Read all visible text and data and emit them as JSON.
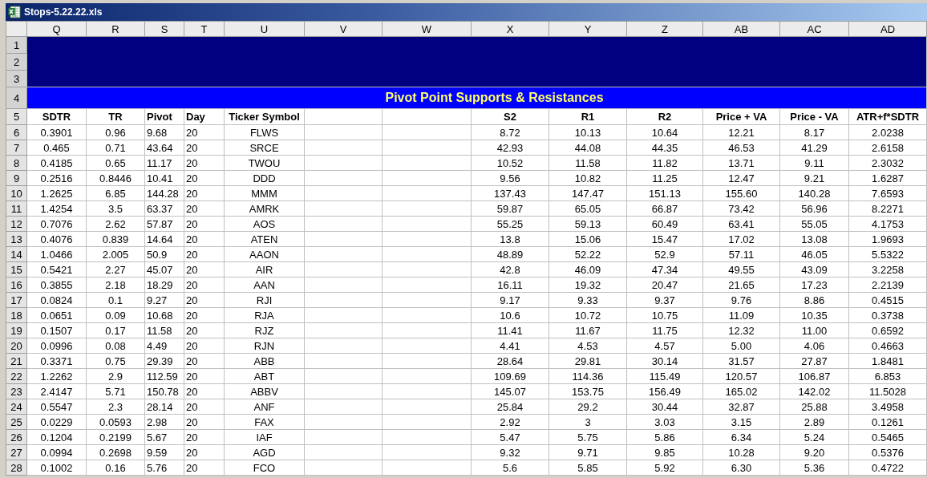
{
  "window": {
    "title": "Stops-5.22.22.xls"
  },
  "columns": [
    {
      "letter": "Q",
      "header": "SDTR"
    },
    {
      "letter": "R",
      "header": "TR"
    },
    {
      "letter": "S",
      "header": "Pivot"
    },
    {
      "letter": "T",
      "header": "Day"
    },
    {
      "letter": "U",
      "header": "Ticker Symbol"
    },
    {
      "letter": "V"
    },
    {
      "letter": "W"
    },
    {
      "letter": "X",
      "header": "S2"
    },
    {
      "letter": "Y",
      "header": "R1"
    },
    {
      "letter": "Z",
      "header": "R2"
    },
    {
      "letter": "AB",
      "header": "Price + VA"
    },
    {
      "letter": "AC",
      "header": "Price - VA"
    },
    {
      "letter": "AD",
      "header": "ATR+f*SDTR"
    }
  ],
  "banner": {
    "band_rows": [
      "1",
      "2",
      "3"
    ],
    "title_row": "4",
    "title": "Pivot Point Supports & Resistances"
  },
  "header_row": "5",
  "rows": [
    {
      "row_number": "6",
      "cells": [
        "0.3901",
        "0.96",
        "9.68",
        "20",
        "FLWS",
        "8.72",
        "10.13",
        "10.64",
        "12.21",
        "8.17",
        "2.0238"
      ]
    },
    {
      "row_number": "7",
      "cells": [
        "0.465",
        "0.71",
        "43.64",
        "20",
        "SRCE",
        "42.93",
        "44.08",
        "44.35",
        "46.53",
        "41.29",
        "2.6158"
      ]
    },
    {
      "row_number": "8",
      "cells": [
        "0.4185",
        "0.65",
        "11.17",
        "20",
        "TWOU",
        "10.52",
        "11.58",
        "11.82",
        "13.71",
        "9.11",
        "2.3032"
      ]
    },
    {
      "row_number": "9",
      "cells": [
        "0.2516",
        "0.8446",
        "10.41",
        "20",
        "DDD",
        "9.56",
        "10.82",
        "11.25",
        "12.47",
        "9.21",
        "1.6287"
      ]
    },
    {
      "row_number": "10",
      "cells": [
        "1.2625",
        "6.85",
        "144.28",
        "20",
        "MMM",
        "137.43",
        "147.47",
        "151.13",
        "155.60",
        "140.28",
        "7.6593"
      ]
    },
    {
      "row_number": "11",
      "cells": [
        "1.4254",
        "3.5",
        "63.37",
        "20",
        "AMRK",
        "59.87",
        "65.05",
        "66.87",
        "73.42",
        "56.96",
        "8.2271"
      ]
    },
    {
      "row_number": "12",
      "cells": [
        "0.7076",
        "2.62",
        "57.87",
        "20",
        "AOS",
        "55.25",
        "59.13",
        "60.49",
        "63.41",
        "55.05",
        "4.1753"
      ]
    },
    {
      "row_number": "13",
      "cells": [
        "0.4076",
        "0.839",
        "14.64",
        "20",
        "ATEN",
        "13.8",
        "15.06",
        "15.47",
        "17.02",
        "13.08",
        "1.9693"
      ]
    },
    {
      "row_number": "14",
      "cells": [
        "1.0466",
        "2.005",
        "50.9",
        "20",
        "AAON",
        "48.89",
        "52.22",
        "52.9",
        "57.11",
        "46.05",
        "5.5322"
      ]
    },
    {
      "row_number": "15",
      "cells": [
        "0.5421",
        "2.27",
        "45.07",
        "20",
        "AIR",
        "42.8",
        "46.09",
        "47.34",
        "49.55",
        "43.09",
        "3.2258"
      ]
    },
    {
      "row_number": "16",
      "cells": [
        "0.3855",
        "2.18",
        "18.29",
        "20",
        "AAN",
        "16.11",
        "19.32",
        "20.47",
        "21.65",
        "17.23",
        "2.2139"
      ]
    },
    {
      "row_number": "17",
      "cells": [
        "0.0824",
        "0.1",
        "9.27",
        "20",
        "RJI",
        "9.17",
        "9.33",
        "9.37",
        "9.76",
        "8.86",
        "0.4515"
      ]
    },
    {
      "row_number": "18",
      "cells": [
        "0.0651",
        "0.09",
        "10.68",
        "20",
        "RJA",
        "10.6",
        "10.72",
        "10.75",
        "11.09",
        "10.35",
        "0.3738"
      ]
    },
    {
      "row_number": "19",
      "cells": [
        "0.1507",
        "0.17",
        "11.58",
        "20",
        "RJZ",
        "11.41",
        "11.67",
        "11.75",
        "12.32",
        "11.00",
        "0.6592"
      ]
    },
    {
      "row_number": "20",
      "cells": [
        "0.0996",
        "0.08",
        "4.49",
        "20",
        "RJN",
        "4.41",
        "4.53",
        "4.57",
        "5.00",
        "4.06",
        "0.4663"
      ]
    },
    {
      "row_number": "21",
      "cells": [
        "0.3371",
        "0.75",
        "29.39",
        "20",
        "ABB",
        "28.64",
        "29.81",
        "30.14",
        "31.57",
        "27.87",
        "1.8481"
      ]
    },
    {
      "row_number": "22",
      "cells": [
        "1.2262",
        "2.9",
        "112.59",
        "20",
        "ABT",
        "109.69",
        "114.36",
        "115.49",
        "120.57",
        "106.87",
        "6.853"
      ]
    },
    {
      "row_number": "23",
      "cells": [
        "2.4147",
        "5.71",
        "150.78",
        "20",
        "ABBV",
        "145.07",
        "153.75",
        "156.49",
        "165.02",
        "142.02",
        "11.5028"
      ]
    },
    {
      "row_number": "24",
      "cells": [
        "0.5547",
        "2.3",
        "28.14",
        "20",
        "ANF",
        "25.84",
        "29.2",
        "30.44",
        "32.87",
        "25.88",
        "3.4958"
      ]
    },
    {
      "row_number": "25",
      "cells": [
        "0.0229",
        "0.0593",
        "2.98",
        "20",
        "FAX",
        "2.92",
        "3",
        "3.03",
        "3.15",
        "2.89",
        "0.1261"
      ]
    },
    {
      "row_number": "26",
      "cells": [
        "0.1204",
        "0.2199",
        "5.67",
        "20",
        "IAF",
        "5.47",
        "5.75",
        "5.86",
        "6.34",
        "5.24",
        "0.5465"
      ]
    },
    {
      "row_number": "27",
      "cells": [
        "0.0994",
        "0.2698",
        "9.59",
        "20",
        "AGD",
        "9.32",
        "9.71",
        "9.85",
        "10.28",
        "9.20",
        "0.5376"
      ]
    },
    {
      "row_number": "28",
      "cells": [
        "0.1002",
        "0.16",
        "5.76",
        "20",
        "FCO",
        "5.6",
        "5.85",
        "5.92",
        "6.30",
        "5.36",
        "0.4722"
      ]
    }
  ]
}
